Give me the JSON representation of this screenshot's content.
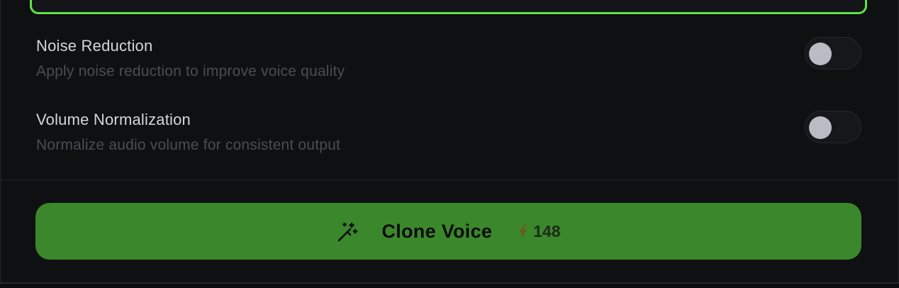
{
  "settings": [
    {
      "title": "Noise Reduction",
      "description": "Apply noise reduction to improve voice quality",
      "enabled": false
    },
    {
      "title": "Volume Normalization",
      "description": "Normalize audio volume for consistent output",
      "enabled": false
    }
  ],
  "clone_button": {
    "label": "Clone Voice",
    "icon": "magic-wand-icon",
    "credit_icon": "lightning-bolt-icon",
    "credit_cost": "148"
  },
  "colors": {
    "accent_focus": "#5ee34a",
    "button_bg": "#3b872b",
    "background": "#0f1012",
    "toggle_knob": "#b9bcc2",
    "bolt": "#6a5a1e"
  }
}
